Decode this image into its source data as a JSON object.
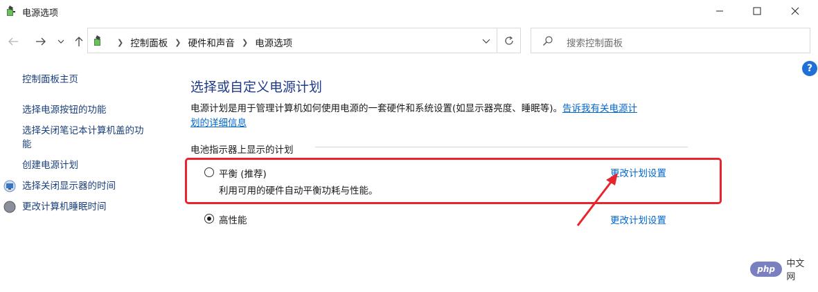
{
  "window": {
    "title": "电源选项"
  },
  "address_bar": {
    "crumbs": [
      "控制面板",
      "硬件和声音",
      "电源选项"
    ]
  },
  "search": {
    "placeholder": "搜索控制面板"
  },
  "sidebar": {
    "home": "控制面板主页",
    "items": [
      {
        "label": "选择电源按钮的功能"
      },
      {
        "label": "选择关闭笔记本计算机盖的功能"
      },
      {
        "label": "创建电源计划"
      },
      {
        "label": "选择关闭显示器的时间"
      },
      {
        "label": "更改计算机睡眠时间"
      }
    ],
    "item2_line1": "选择关闭笔记本计算机盖的功",
    "item2_line2": "能"
  },
  "main": {
    "heading": "选择或自定义电源计划",
    "description": "电源计划是用于管理计算机如何使用电源的一套硬件和系统设置(如显示器亮度、睡眠等)。",
    "link_part1": "告诉我有关电源计",
    "link_part2": "划的详细信息",
    "group_label": "电池指示器上显示的计划",
    "plans": [
      {
        "name": "平衡 (推荐)",
        "description": "利用可用的硬件自动平衡功耗与性能。",
        "selected": false,
        "change_link": "更改计划设置"
      },
      {
        "name": "高性能",
        "description": "",
        "selected": true,
        "change_link": "更改计划设置"
      }
    ]
  },
  "help": {
    "label": "?"
  },
  "watermark": {
    "logo": "php",
    "text": "中文网"
  },
  "colors": {
    "highlight_box": "#e8242c",
    "link": "#0066cc",
    "heading": "#1e3a8a"
  }
}
